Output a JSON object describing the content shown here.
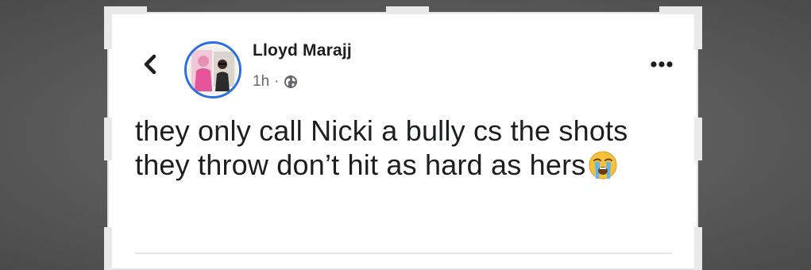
{
  "post": {
    "author": "Lloyd Marajj",
    "time": "1h",
    "separator": "·",
    "audience_icon": "globe-icon",
    "text": "they only call Nicki a bully cs the shots they throw don’t hit as hard as hers",
    "emoji": "loudly-crying-face"
  },
  "icons": {
    "back": "back-chevron-icon",
    "more": "more-options-icon"
  },
  "colors": {
    "avatar_ring": "#2d6fe0",
    "text": "#1c1e21",
    "meta": "#65676b"
  }
}
